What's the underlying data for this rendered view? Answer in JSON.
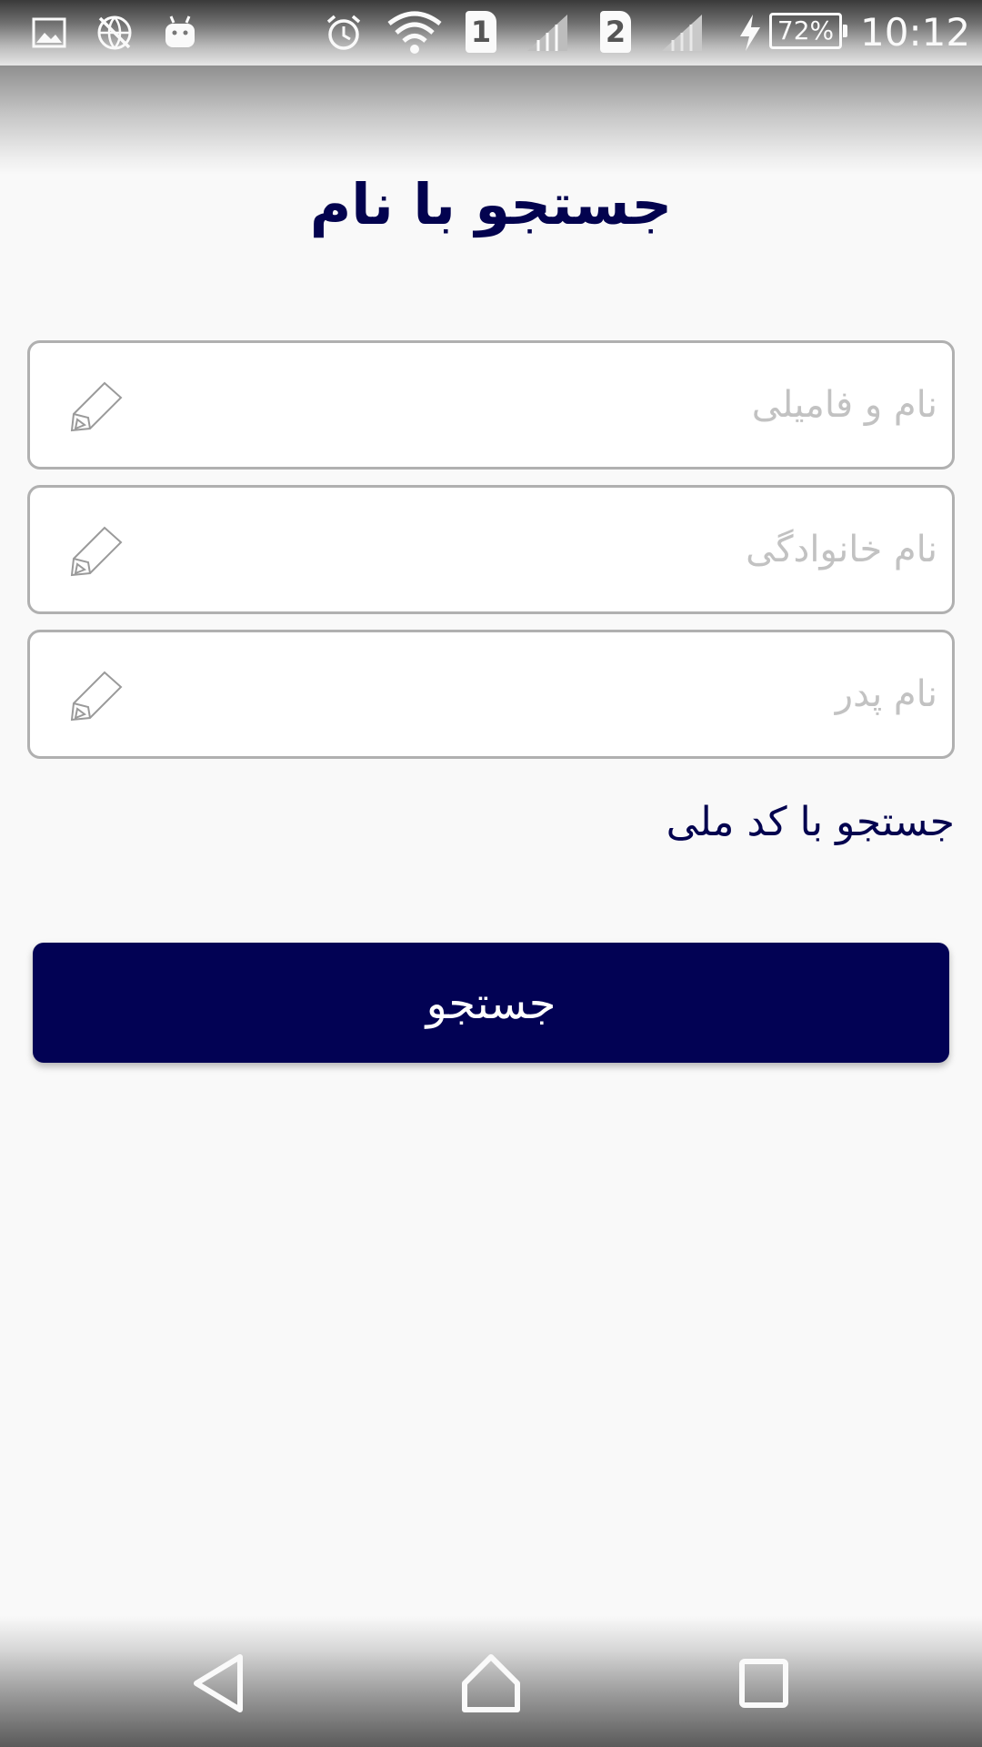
{
  "status_bar": {
    "icons": [
      "gallery-icon",
      "vpn-off-icon",
      "android-debug-icon",
      "alarm-icon",
      "wifi-icon",
      "signal-sim1-icon",
      "signal-sim2-icon",
      "charging-icon"
    ],
    "sim1_label": "1",
    "sim2_label": "2",
    "battery": "72%",
    "time": "10:12"
  },
  "page": {
    "title": "جستجو با نام"
  },
  "form": {
    "full_name_placeholder": "نام و فامیلی",
    "family_name_placeholder": "نام خانوادگی",
    "father_name_placeholder": "نام پدر",
    "edit_icon": "pencil-icon"
  },
  "national_code_link": "جستجو با کد ملی",
  "search_button_label": "جستجو",
  "nav_bar": {
    "icons": [
      "back-icon",
      "home-icon",
      "recents-icon"
    ]
  },
  "colors": {
    "primary": "#020254",
    "title_text": "#03034f",
    "field_border": "#b0b0b0",
    "placeholder": "#c2c2c2",
    "background": "#f9f9f9"
  }
}
